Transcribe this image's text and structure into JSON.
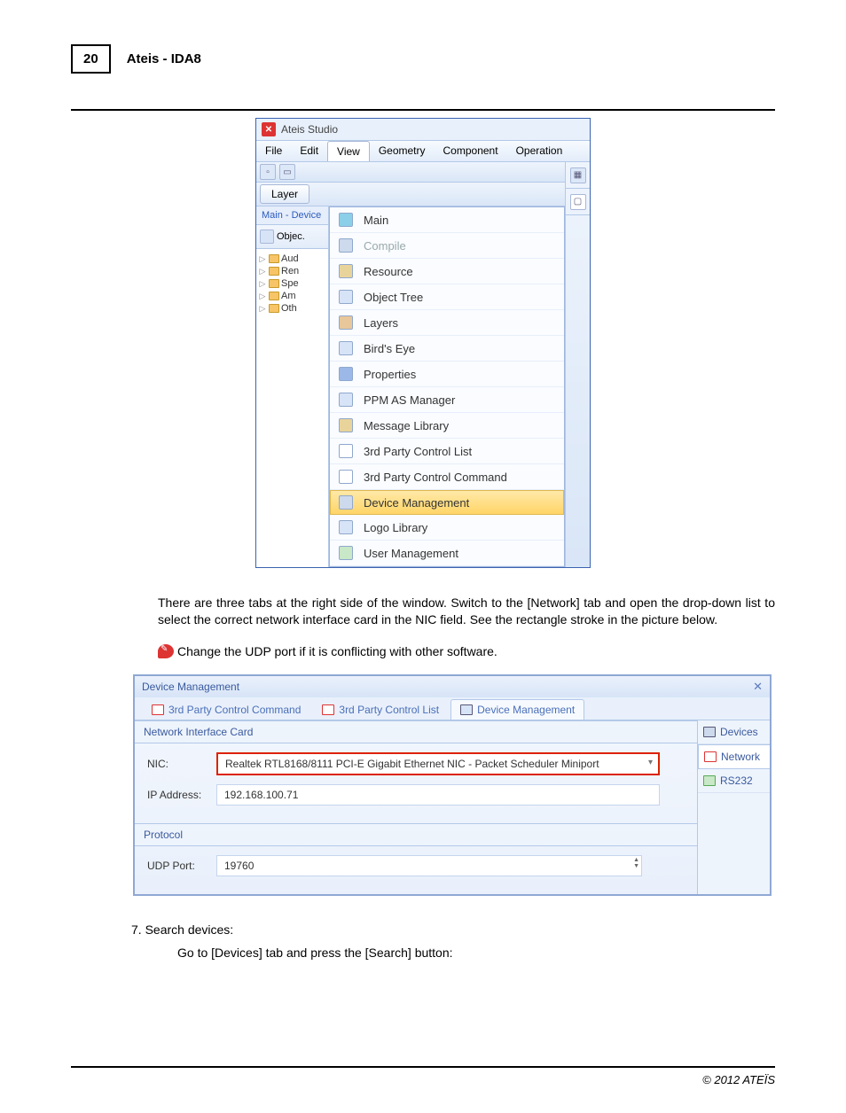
{
  "page": {
    "number": "20",
    "header": "Ateis - IDA8",
    "footer": "© 2012 ATEÏS"
  },
  "screenshot1": {
    "title": "Ateis Studio",
    "menus": {
      "file": "File",
      "edit": "Edit",
      "view": "View",
      "geometry": "Geometry",
      "component": "Component",
      "operation": "Operation"
    },
    "layer_btn": "Layer",
    "left": {
      "main_device": "Main - Device",
      "objec": "Objec.",
      "tree": [
        "Aud",
        "Ren",
        "Spe",
        "Am",
        "Oth"
      ]
    },
    "view_items": [
      {
        "label": "Main",
        "greyed": false,
        "icon_bg": "#8bd0e8"
      },
      {
        "label": "Compile",
        "greyed": true,
        "icon_bg": "#cdd9ec"
      },
      {
        "label": "Resource",
        "greyed": false,
        "icon_bg": "#e8d49b"
      },
      {
        "label": "Object Tree",
        "greyed": false,
        "icon_bg": "#d7e4f7"
      },
      {
        "label": "Layers",
        "greyed": false,
        "icon_bg": "#e8c79b"
      },
      {
        "label": "Bird's Eye",
        "greyed": false,
        "icon_bg": "#d7e4f7"
      },
      {
        "label": "Properties",
        "greyed": false,
        "icon_bg": "#9bb8e8"
      },
      {
        "label": "PPM AS Manager",
        "greyed": false,
        "icon_bg": "#d7e4f7"
      },
      {
        "label": "Message Library",
        "greyed": false,
        "icon_bg": "#e8d49b"
      },
      {
        "label": "3rd Party Control List",
        "greyed": false,
        "icon_bg": "#fff"
      },
      {
        "label": "3rd Party Control Command",
        "greyed": false,
        "icon_bg": "#fff"
      },
      {
        "label": "Device Management",
        "greyed": false,
        "icon_bg": "#cdd9ec",
        "highlight": true
      },
      {
        "label": "Logo Library",
        "greyed": false,
        "icon_bg": "#d7e4f7"
      },
      {
        "label": "User Management",
        "greyed": false,
        "icon_bg": "#c8e8c8"
      }
    ]
  },
  "body": {
    "para1": "There are three tabs at the right side of the window. Switch to the [Network] tab and open the drop-down list to select the correct network interface card in the NIC field. See the rectangle stroke in the picture below.",
    "tip": "Change the UDP port if it is conflicting with other software."
  },
  "screenshot2": {
    "title": "Device Management",
    "tabs": {
      "cmd": "3rd Party Control Command",
      "list": "3rd Party Control List",
      "dm": "Device Management"
    },
    "right_tabs": {
      "devices": "Devices",
      "network": "Network",
      "rs232": "RS232"
    },
    "group1": "Network Interface Card",
    "nic_label": "NIC:",
    "nic_value": "Realtek RTL8168/8111 PCI-E Gigabit Ethernet NIC - Packet Scheduler Miniport",
    "ip_label": "IP Address:",
    "ip_value": "192.168.100.71",
    "group2": "Protocol",
    "udp_label": "UDP Port:",
    "udp_value": "19760"
  },
  "footer_body": {
    "step7": "7.  Search devices:",
    "step7_detail": "Go to [Devices] tab and press the [Search] button:"
  }
}
